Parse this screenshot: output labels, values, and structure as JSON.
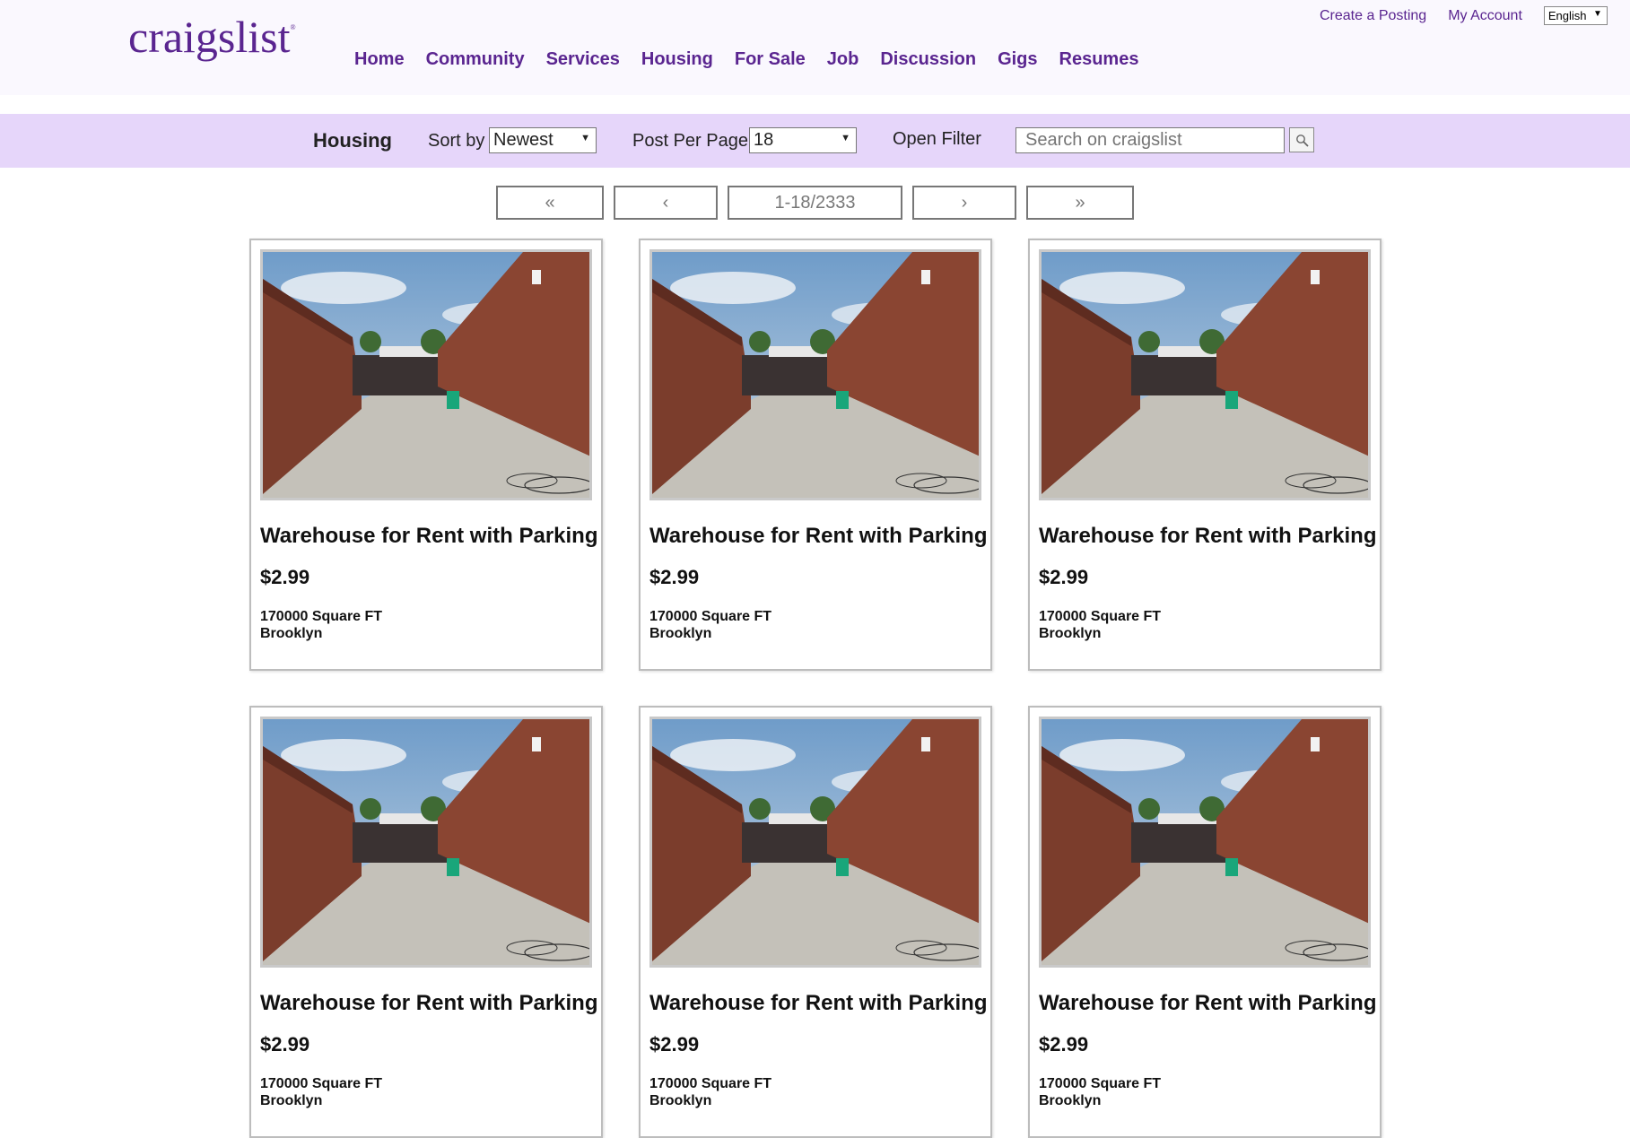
{
  "header": {
    "logo": "craigslist",
    "nav": [
      "Home",
      "Community",
      "Services",
      "Housing",
      "For Sale",
      "Job",
      "Discussion",
      "Gigs",
      "Resumes"
    ],
    "create_posting": "Create a Posting",
    "my_account": "My Account",
    "language": "English"
  },
  "toolbar": {
    "title": "Housing",
    "sort_label": "Sort by",
    "sort_value": "Newest",
    "per_page_label": "Post Per Page",
    "per_page_value": "18",
    "open_filter": "Open Filter",
    "search_placeholder": "Search on craigslist"
  },
  "pager": {
    "first": "«",
    "prev": "‹",
    "range": "1-18/2333",
    "next": "›",
    "last": "»"
  },
  "listings": [
    {
      "title": "Warehouse for Rent with Parking",
      "price": "$2.99",
      "size": "170000 Square FT",
      "location": "Brooklyn"
    },
    {
      "title": "Warehouse for Rent with Parking",
      "price": "$2.99",
      "size": "170000 Square FT",
      "location": "Brooklyn"
    },
    {
      "title": "Warehouse for Rent with Parking",
      "price": "$2.99",
      "size": "170000 Square FT",
      "location": "Brooklyn"
    },
    {
      "title": "Warehouse for Rent with Parking",
      "price": "$2.99",
      "size": "170000 Square FT",
      "location": "Brooklyn"
    },
    {
      "title": "Warehouse for Rent with Parking",
      "price": "$2.99",
      "size": "170000 Square FT",
      "location": "Brooklyn"
    },
    {
      "title": "Warehouse for Rent with Parking",
      "price": "$2.99",
      "size": "170000 Square FT",
      "location": "Brooklyn"
    }
  ],
  "colors": {
    "brand": "#5a2590",
    "toolbar_bg": "#e6d6fa",
    "header_bg": "#faf8fe"
  }
}
